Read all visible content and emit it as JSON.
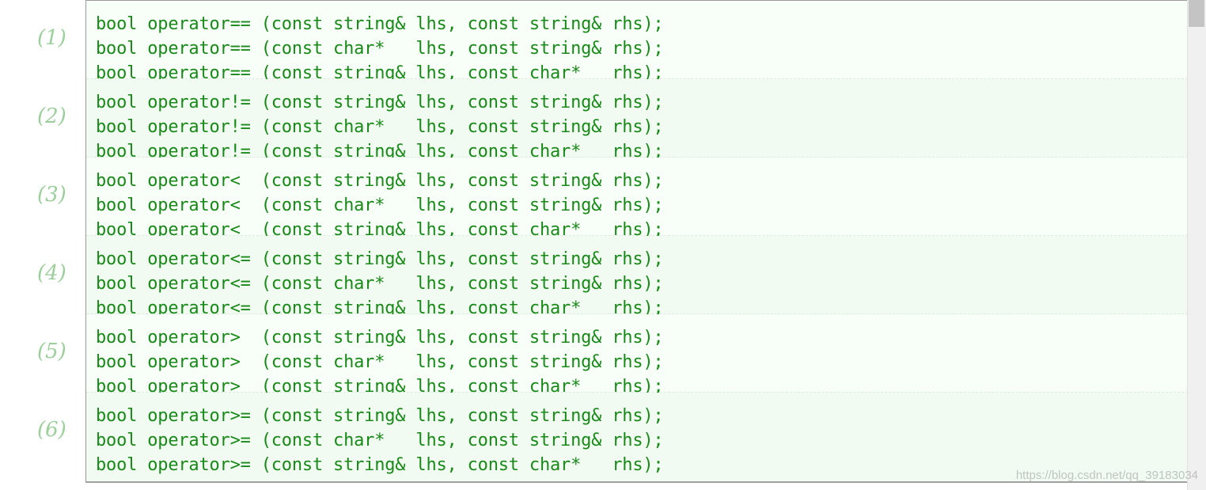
{
  "groups": [
    {
      "num": "(1)",
      "lines": [
        "bool operator== (const string& lhs, const string& rhs);",
        "bool operator== (const char*   lhs, const string& rhs);",
        "bool operator== (const string& lhs, const char*   rhs);"
      ]
    },
    {
      "num": "(2)",
      "lines": [
        "bool operator!= (const string& lhs, const string& rhs);",
        "bool operator!= (const char*   lhs, const string& rhs);",
        "bool operator!= (const string& lhs, const char*   rhs);"
      ]
    },
    {
      "num": "(3)",
      "lines": [
        "bool operator<  (const string& lhs, const string& rhs);",
        "bool operator<  (const char*   lhs, const string& rhs);",
        "bool operator<  (const string& lhs, const char*   rhs);"
      ]
    },
    {
      "num": "(4)",
      "lines": [
        "bool operator<= (const string& lhs, const string& rhs);",
        "bool operator<= (const char*   lhs, const string& rhs);",
        "bool operator<= (const string& lhs, const char*   rhs);"
      ]
    },
    {
      "num": "(5)",
      "lines": [
        "bool operator>  (const string& lhs, const string& rhs);",
        "bool operator>  (const char*   lhs, const string& rhs);",
        "bool operator>  (const string& lhs, const char*   rhs);"
      ]
    },
    {
      "num": "(6)",
      "lines": [
        "bool operator>= (const string& lhs, const string& rhs);",
        "bool operator>= (const char*   lhs, const string& rhs);",
        "bool operator>= (const string& lhs, const char*   rhs);"
      ]
    }
  ],
  "watermark": "https://blog.csdn.net/qq_39183034"
}
